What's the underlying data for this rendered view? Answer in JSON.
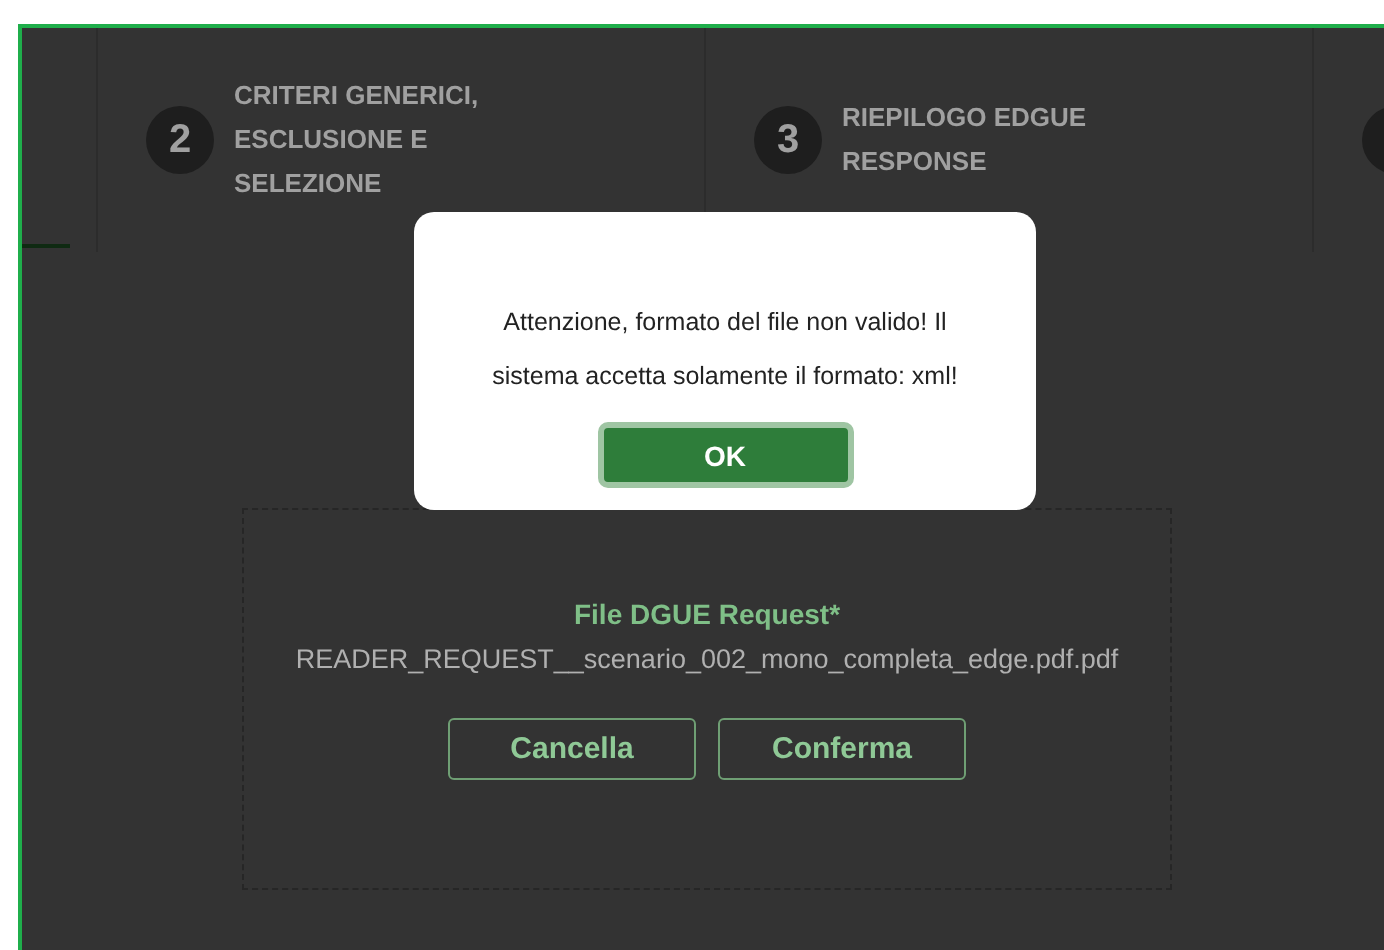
{
  "steps": [
    {
      "selected": true
    },
    {
      "number": "2",
      "label": "CRITERI GENERICI, ESCLUSIONE E SELEZIONE",
      "selected": false
    },
    {
      "number": "3",
      "label": "RIEPILOGO EDGUE RESPONSE",
      "selected": false
    },
    {
      "selected": false
    }
  ],
  "upload": {
    "title": "File DGUE Request*",
    "file_name": "READER_REQUEST__scenario_002_mono_completa_edge.pdf.pdf",
    "buttons": [
      "Cancella",
      "Conferma"
    ]
  },
  "dialog": {
    "message": "Attenzione, formato del file non valido! Il sistema accetta solamente il formato: xml!",
    "button": "OK"
  }
}
